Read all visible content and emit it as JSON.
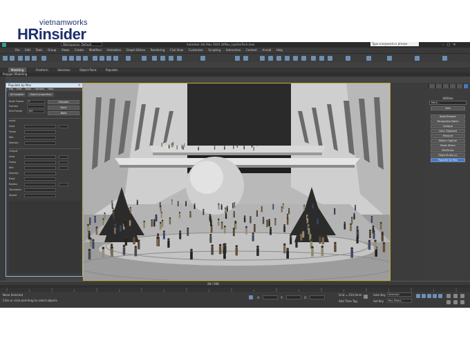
{
  "branding": {
    "top_text": "vietnamworks",
    "main_text": "HRinsider"
  },
  "window": {
    "title": "Autodesk 3ds Max 2020   3dMax_LopVanTech.max",
    "workspace": "Workspaces: Default",
    "search_placeholder": "Type a keyword or phrase"
  },
  "menu": [
    "File",
    "Edit",
    "Tools",
    "Group",
    "Views",
    "Create",
    "Modifiers",
    "Animation",
    "Graph Editors",
    "Rendering",
    "Civil View",
    "Customize",
    "Scripting",
    "Interactive",
    "Content",
    "Arnold",
    "Help"
  ],
  "ribbon": {
    "tabs": [
      "Modeling",
      "Freeform",
      "Selection",
      "Object Paint",
      "Populate"
    ],
    "active_tab": "Modeling",
    "sub_label": "Polygon Modeling"
  },
  "dialog": {
    "title": "Populate by Max",
    "menu": [
      "File",
      "Edit",
      "Tools",
      "Options",
      "Help"
    ],
    "tabs": [
      "All Loaded",
      "Object properties"
    ],
    "start_label": "Start Frame",
    "end_label": "End Frame",
    "fps_label": "Frames",
    "start_value": "0",
    "end_value": "100",
    "buttons": [
      "Simulate",
      "Done",
      "Bake"
    ],
    "section_input": "Input",
    "section_output": "Output",
    "input_rows": [
      "Area",
      "Flows",
      "Idle",
      "Density"
    ],
    "output_rows": [
      "Area",
      "Flows",
      "Idle",
      "Density",
      "Ease",
      "Radius",
      "Transform",
      "Speed"
    ]
  },
  "right_panel": {
    "header": "Utilities",
    "dropdown": "More...",
    "sets": "Sets",
    "buttons": [
      "Asset Browser",
      "Perspective Match",
      "Collapse",
      "Color Clipboard",
      "Measure",
      "Motion Capture",
      "Reset XForm",
      "MAXScript",
      "Flight Studio (c)",
      "Populate by Max"
    ],
    "active_button": "Populate by Max"
  },
  "timeline": {
    "readout": "28 / 100"
  },
  "statusbar": {
    "left_top": "None Selected",
    "left_bottom": "Click or click-and-drag to select objects",
    "x_label": "X:",
    "y_label": "Y:",
    "z_label": "Z:",
    "grid": "Grid = 254.0mm",
    "addtime": "Add Time Tag",
    "autokey": "Auto Key",
    "selected": "Selected",
    "setkey": "Set Key",
    "keyfilters": "Key Filters..."
  },
  "colors": {
    "accent_blue": "#4a78b8",
    "viewport_border": "#d0a830",
    "brand": "#1c2f6d"
  }
}
